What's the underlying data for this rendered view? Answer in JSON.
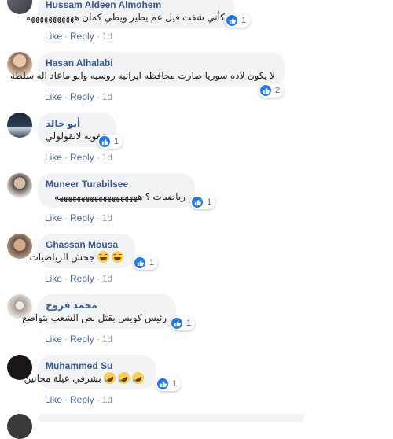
{
  "comments": [
    {
      "author": "Hussam Aldeen Almohem",
      "text": "كأني شفت فيل عم يطير ويطي كمان هههههههههههه",
      "reaction_count": "1",
      "actions": {
        "like": "Like",
        "reply": "Reply",
        "time": "1d"
      }
    },
    {
      "author": "Hasan Alhalabi",
      "text": "لا يكون لاده سوريا صارت محافظه ايرانيه روسيه وابو ماعاد اله سلطه",
      "reaction_count": "2",
      "actions": {
        "like": "Like",
        "reply": "Reply",
        "time": "1d"
      }
    },
    {
      "author": "أبو خالد",
      "text": "عفوية لاتقولولي",
      "reaction_count": "1",
      "actions": {
        "like": "Like",
        "reply": "Reply",
        "time": "1d"
      }
    },
    {
      "author": "Muneer Turabilsee",
      "text": "رياضيات ؟ هههههههههههههههههههه",
      "reaction_count": "1",
      "actions": {
        "like": "Like",
        "reply": "Reply",
        "time": "1d"
      }
    },
    {
      "author": "Ghassan Mousa",
      "text": "جحش الرياضيات",
      "reaction_count": "1",
      "actions": {
        "like": "Like",
        "reply": "Reply",
        "time": "1d"
      }
    },
    {
      "author": "محمد فروح",
      "text": "رئيس كويس بقتل نص الشعب بتواضع",
      "reaction_count": "1",
      "actions": {
        "like": "Like",
        "reply": "Reply",
        "time": "1d"
      }
    },
    {
      "author": "Muhammed Su",
      "text": "بشرفي عيلة مجانين",
      "reaction_count": "1",
      "actions": {
        "like": "Like",
        "reply": "Reply",
        "time": "1d"
      }
    }
  ],
  "colors": {
    "author": "#385898",
    "link": "#4b67a1",
    "bubble": "#f2f3f5",
    "like_blue": "#2078f4",
    "meta": "#90949c"
  },
  "icons": {
    "reaction": "like-thumb-icon",
    "emoji_lol": "grinning-squinting-face-icon",
    "emoji_rofl": "rolling-on-floor-laughing-icon"
  }
}
